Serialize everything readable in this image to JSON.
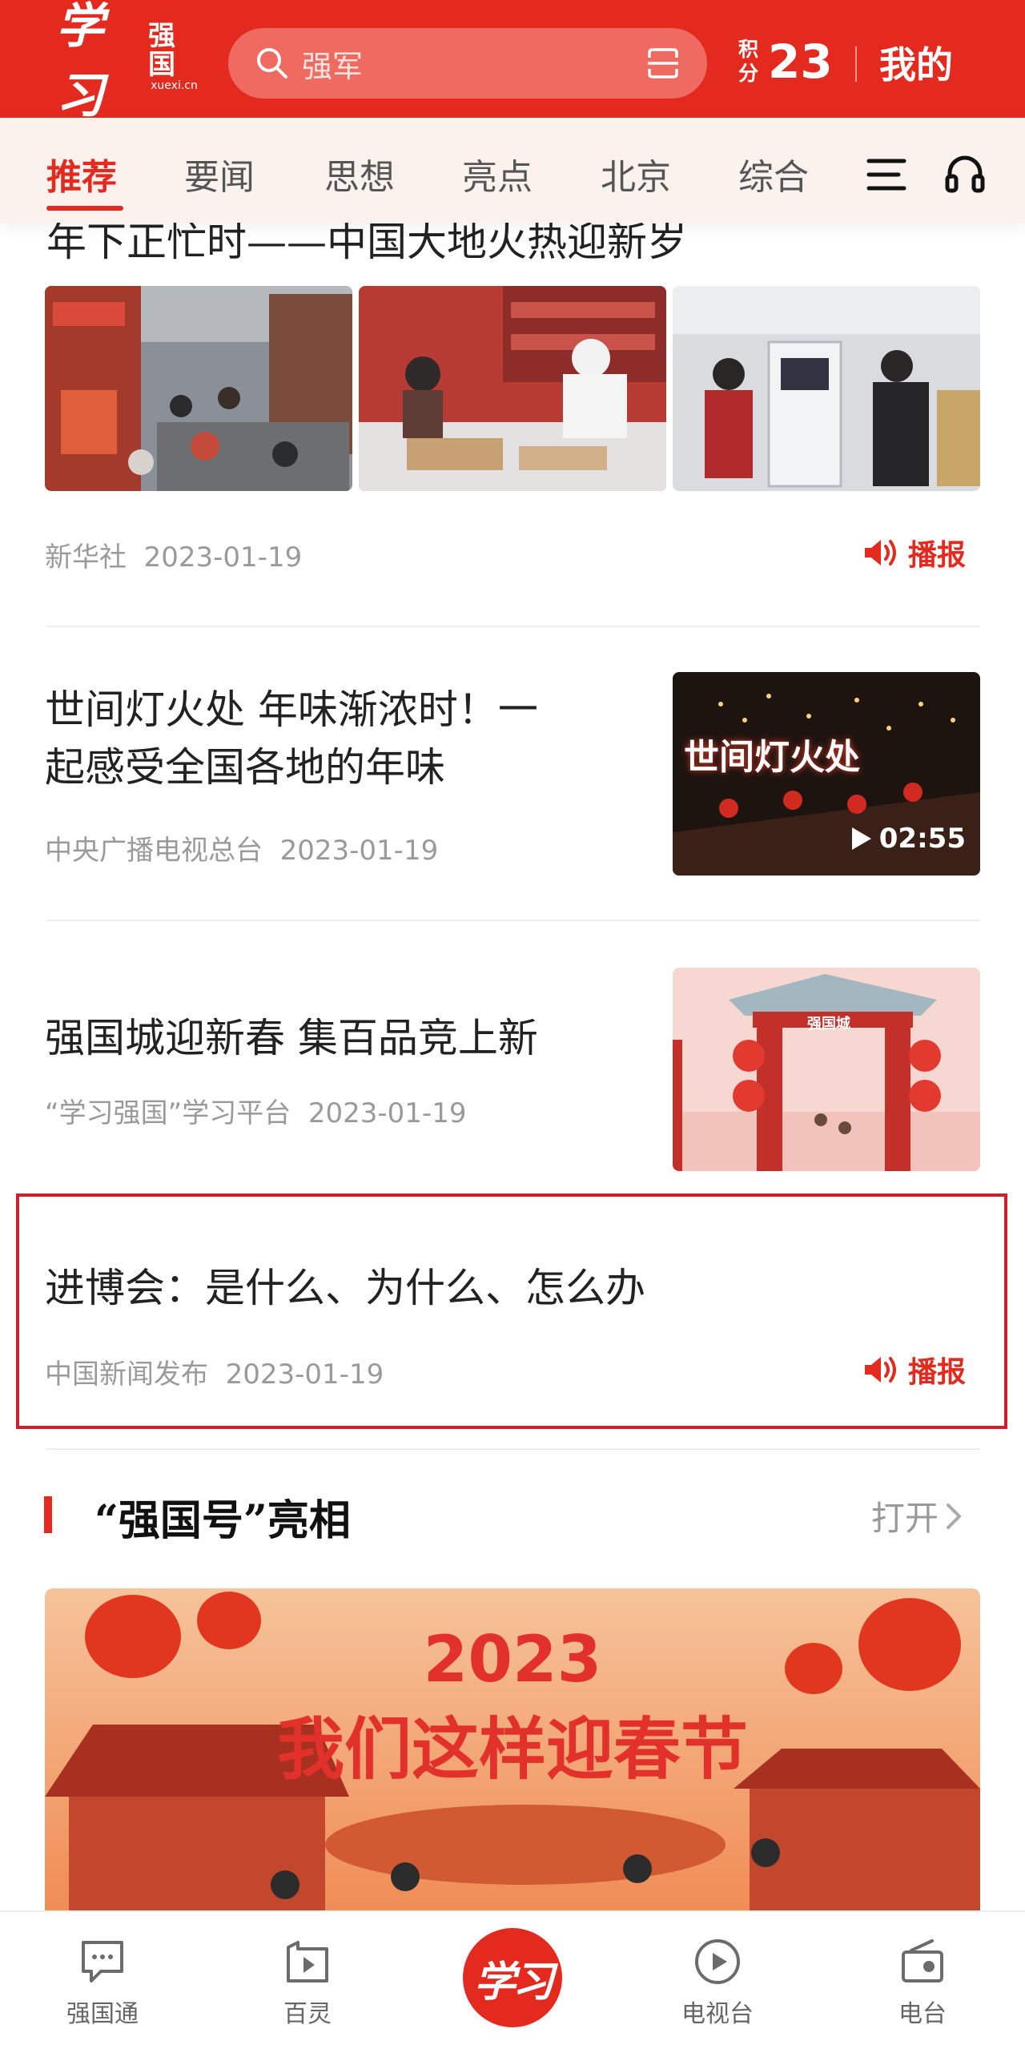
{
  "header": {
    "logo_script": "学习",
    "logo_text": "强国",
    "logo_domain": "xuexi.cn",
    "search_placeholder": "强军",
    "points_label_1": "积",
    "points_label_2": "分",
    "points_value": "23",
    "mine_label": "我的"
  },
  "tabs": [
    {
      "label": "推荐",
      "active": true
    },
    {
      "label": "要闻"
    },
    {
      "label": "思想"
    },
    {
      "label": "亮点"
    },
    {
      "label": "北京"
    },
    {
      "label": "综合"
    }
  ],
  "feed": {
    "item1": {
      "title_peek": "年下正忙时——中国大地火热迎新岁",
      "source": "新华社",
      "date": "2023-01-19",
      "broadcast": "播报"
    },
    "item2": {
      "title": "世间灯火处  年味渐浓时！一起感受全国各地的年味",
      "title_line1": "世间灯火处  年味渐浓时！一",
      "title_line2": "起感受全国各地的年味",
      "source": "中央广播电视总台",
      "date": "2023-01-19",
      "video_duration": "02:55",
      "thumb_text": "世间灯火处"
    },
    "item3": {
      "title": "强国城迎新春  集百品竞上新",
      "source": "“学习强国”学习平台",
      "date": "2023-01-19",
      "thumb_sign": "强国城"
    },
    "item4": {
      "title": "进博会：是什么、为什么、怎么办",
      "source": "中国新闻发布",
      "date": "2023-01-19",
      "broadcast": "播报"
    }
  },
  "section": {
    "title": "“强国号”亮相",
    "open_label": "打开"
  },
  "banner": {
    "year": "2023",
    "title": "我们这样迎春节"
  },
  "bottom_nav": [
    {
      "label": "强国通"
    },
    {
      "label": "百灵"
    },
    {
      "label": "学习"
    },
    {
      "label": "电视台"
    },
    {
      "label": "电台"
    }
  ],
  "colors": {
    "brand_red": "#e42a1e",
    "highlight_border": "#c9222a",
    "meta_gray": "#9a9a9a"
  }
}
